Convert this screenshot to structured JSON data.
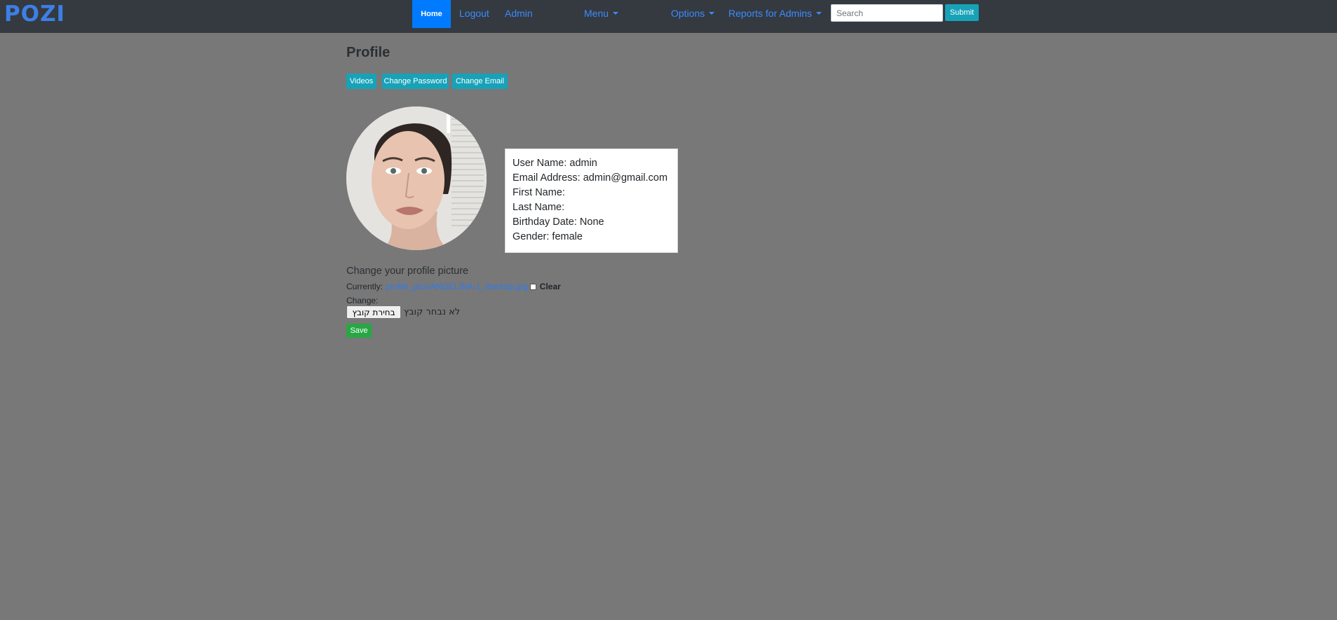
{
  "navbar": {
    "brand": "POZI",
    "home": "Home",
    "logout": "Logout",
    "admin": "Admin",
    "menu": "Menu",
    "options": "Options",
    "reports": "Reports for Admins",
    "search_placeholder": "Search",
    "submit": "Submit"
  },
  "page": {
    "title": "Profile",
    "tabs": [
      "Videos",
      "Change Password",
      "Change Email"
    ]
  },
  "profile": {
    "lines": [
      "User Name: admin",
      "Email Address: admin@gmail.com",
      "First Name:",
      "Last Name:",
      "Birthday Date: None",
      "Gender: female"
    ]
  },
  "picture_form": {
    "title": "Change your profile picture",
    "currently_label": "Currently:",
    "current_file": "profile_pics/ANGELINA-1_ttwchbp.jpg",
    "clear_label": "Clear",
    "change_label": "Change:",
    "file_button": "בחירת קובץ",
    "file_status": "לא נבחר קובץ",
    "save": "Save"
  },
  "colors": {
    "navbar": "#343a40",
    "page_background": "#787878",
    "primary": "#007bff",
    "info": "#17a2b8",
    "success": "#28a745"
  }
}
